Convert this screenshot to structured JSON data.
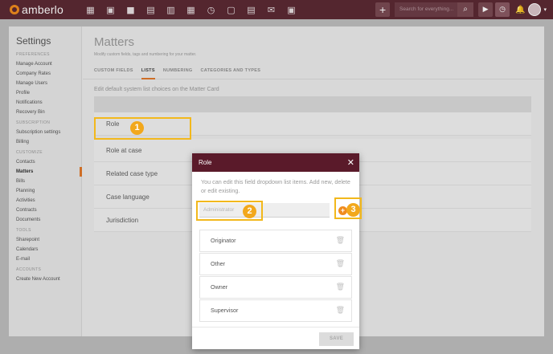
{
  "topbar": {
    "logo_text": "amberlo",
    "nav_icons": [
      "dashboard-icon",
      "contacts-icon",
      "briefcase-icon",
      "documents-icon",
      "bank-icon",
      "calendar-icon",
      "history-icon",
      "folder-icon",
      "inbox-icon",
      "mail-icon",
      "image-icon"
    ],
    "nav_glyphs": [
      "▦",
      "▣",
      "■",
      "▤",
      "▥",
      "▦",
      "◷",
      "▢",
      "▤",
      "✉",
      "▣"
    ],
    "plus_label": "+",
    "search_placeholder": "Search for everything...",
    "search_glyph": "⌕",
    "play_glyph": "▶",
    "timer_glyph": "◷",
    "bell_glyph": "🔔",
    "caret_glyph": "▾"
  },
  "sidebar": {
    "title": "Settings",
    "sections": [
      {
        "header": "PREFERENCES",
        "items": [
          "Manage Account",
          "Company Rates",
          "Manage Users",
          "Profile",
          "Notifications",
          "Recovery Bin"
        ]
      },
      {
        "header": "SUBSCRIPTION",
        "items": [
          "Subscription settings",
          "Billing"
        ]
      },
      {
        "header": "CUSTOMIZE",
        "items": [
          "Contacts",
          "Matters",
          "Bills",
          "Planning",
          "Activities",
          "Contracts",
          "Documents"
        ]
      },
      {
        "header": "TOOLS",
        "items": [
          "Sharepoint",
          "Calendars",
          "E-mail"
        ]
      },
      {
        "header": "ACCOUNTS",
        "items": [
          "Create New Account"
        ]
      }
    ],
    "active_item": "Matters"
  },
  "main": {
    "title": "Matters",
    "subtitle": "Modify custom fields, tags and numbering for your matter.",
    "tabs": [
      "CUSTOM FIELDS",
      "LISTS",
      "NUMBERING",
      "CATEGORIES AND TYPES"
    ],
    "active_tab": "LISTS",
    "section_label": "Edit default system list choices on the Matter Card",
    "rows": [
      "Role",
      "Role at case",
      "Related case type",
      "Case language",
      "Jurisdiction"
    ]
  },
  "modal": {
    "title": "Role",
    "close_glyph": "✕",
    "description": "You can edit this field dropdown list items. Add new, delete or edit existing.",
    "new_item_placeholder": "Administrator",
    "add_glyph": "+",
    "items": [
      "Originator",
      "Other",
      "Owner",
      "Supervisor"
    ],
    "trash_glyph": "🗑",
    "save_label": "SAVE"
  },
  "callouts": [
    "1",
    "2",
    "3"
  ],
  "colors": {
    "brand": "#5c2a34",
    "modal_header": "#5a1a2a",
    "accent": "#e0782a",
    "callout": "#f2b81c"
  }
}
